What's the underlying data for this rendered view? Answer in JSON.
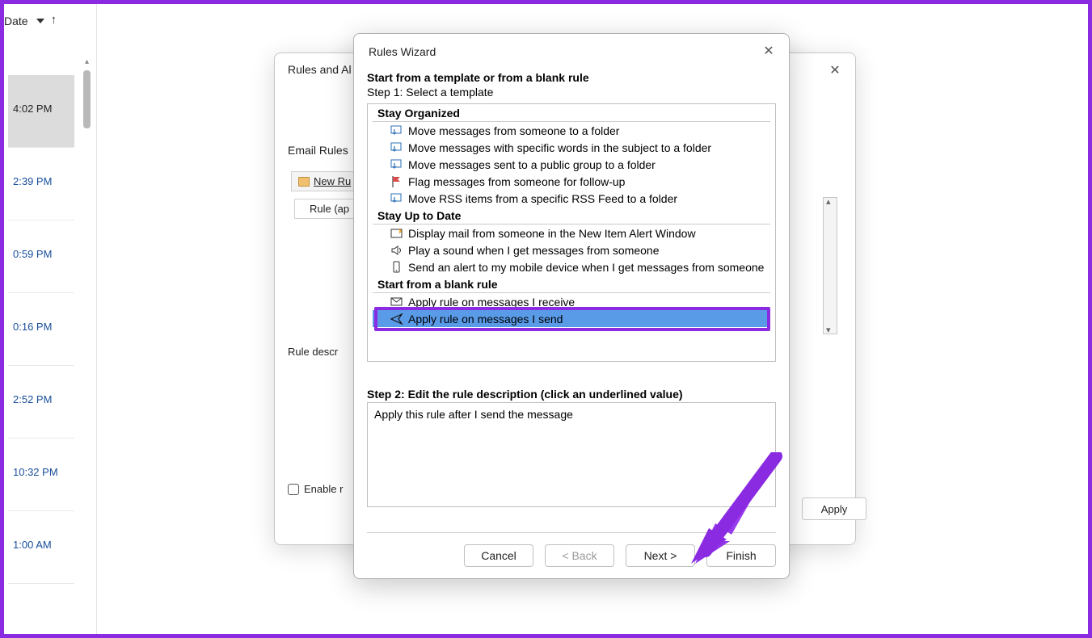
{
  "left_header": {
    "label": "Date"
  },
  "messages": [
    {
      "time": "4:02 PM",
      "selected": true
    },
    {
      "time": "2:39 PM",
      "selected": false
    },
    {
      "time": "0:59 PM",
      "selected": false
    },
    {
      "time": "0:16 PM",
      "selected": false
    },
    {
      "time": "2:52 PM",
      "selected": false
    },
    {
      "time": "10:32 PM",
      "selected": false
    },
    {
      "time": "1:00 AM",
      "selected": false
    }
  ],
  "rules_dialog": {
    "title": "Rules and Al",
    "tab": "Email Rules",
    "new_rule": "New Ru",
    "rule_applied": "Rule (ap",
    "rule_desc": "Rule descr",
    "enable": "Enable r",
    "apply": "Apply"
  },
  "wizard": {
    "title": "Rules Wizard",
    "heading": "Start from a template or from a blank rule",
    "step1": "Step 1: Select a template",
    "categories": {
      "stay_organized": {
        "title": "Stay Organized",
        "opts": [
          "Move messages from someone to a folder",
          "Move messages with specific words in the subject to a folder",
          "Move messages sent to a public group to a folder",
          "Flag messages from someone for follow-up",
          "Move RSS items from a specific RSS Feed to a folder"
        ]
      },
      "stay_uptodate": {
        "title": "Stay Up to Date",
        "opts": [
          "Display mail from someone in the New Item Alert Window",
          "Play a sound when I get messages from someone",
          "Send an alert to my mobile device when I get messages from someone"
        ]
      },
      "blank": {
        "title": "Start from a blank rule",
        "opts": [
          "Apply rule on messages I receive",
          "Apply rule on messages I send"
        ]
      }
    },
    "step2": "Step 2: Edit the rule description (click an underlined value)",
    "desc": "Apply this rule after I send the message",
    "buttons": {
      "cancel": "Cancel",
      "back": "< Back",
      "next": "Next >",
      "finish": "Finish"
    }
  }
}
